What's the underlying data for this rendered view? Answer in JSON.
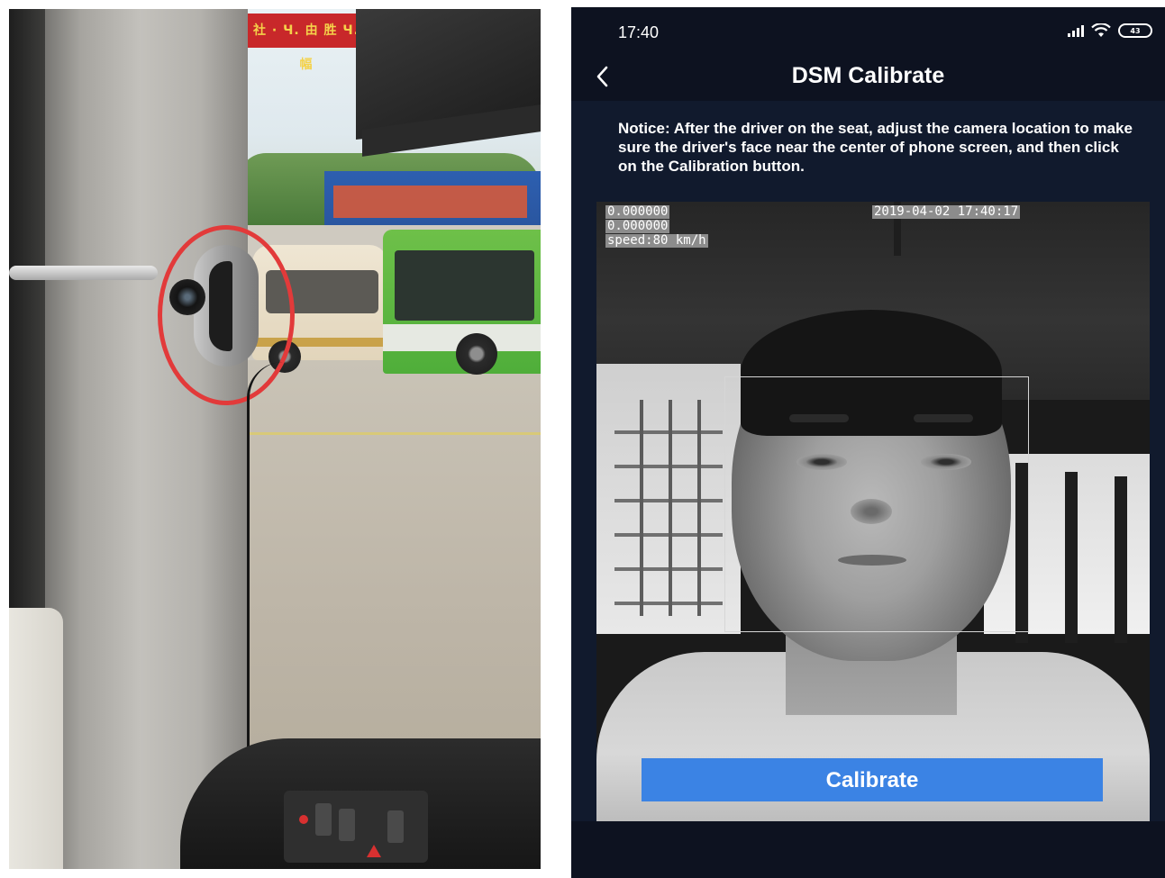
{
  "left_photo": {
    "banner_text": "社 ·  Ч. 由 胜 Ч. 幅"
  },
  "phone": {
    "status_bar": {
      "time": "17:40",
      "battery_label": "43"
    },
    "header": {
      "back_icon": "chevron-left-icon",
      "title": "DSM Calibrate"
    },
    "notice": "Notice: After the driver on the seat, adjust the camera location to make sure the driver's face near the center of phone screen, and then click on the Calibration button.",
    "camera_overlay": {
      "coord_1": "0.000000",
      "coord_2": "0.000000",
      "speed": "speed:80 km/h",
      "timestamp": "2019-04-02 17:40:17"
    },
    "calibrate_button_label": "Calibrate",
    "colors": {
      "accent": "#3b83e4",
      "app_background": "#111a2d",
      "status_background": "#0d1220"
    }
  }
}
